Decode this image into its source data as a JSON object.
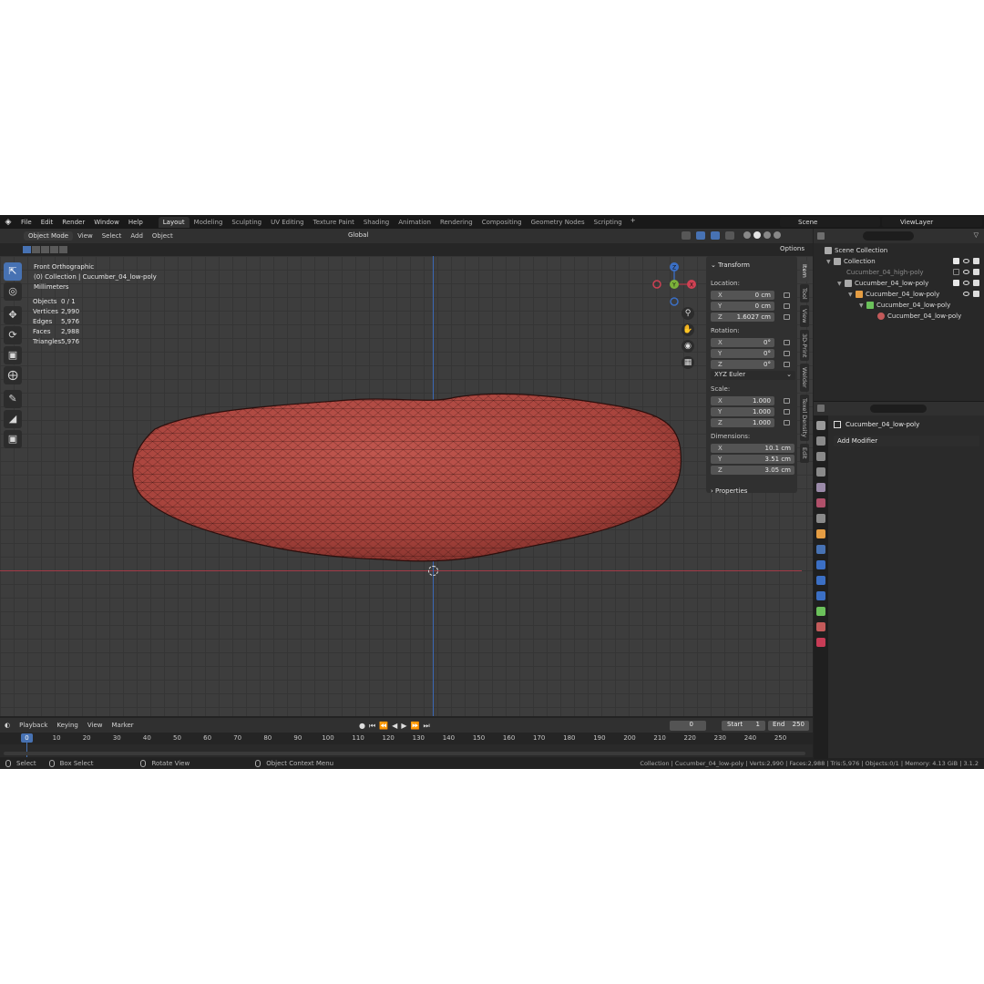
{
  "topbar": {
    "menus": [
      "File",
      "Edit",
      "Render",
      "Window",
      "Help"
    ],
    "workspaces": [
      "Layout",
      "Modeling",
      "Sculpting",
      "UV Editing",
      "Texture Paint",
      "Shading",
      "Animation",
      "Rendering",
      "Compositing",
      "Geometry Nodes",
      "Scripting"
    ],
    "active_workspace": "Layout",
    "add_workspace": "+",
    "scene": "Scene",
    "view_layer": "ViewLayer"
  },
  "viewport_header": {
    "mode": "Object Mode",
    "menus": [
      "View",
      "Select",
      "Add",
      "Object"
    ],
    "orientation": "Global",
    "options": "Options"
  },
  "viewport": {
    "view_name": "Front Orthographic",
    "collection_line": "(0) Collection | Cucumber_04_low-poly",
    "units": "Millimeters",
    "stats": [
      {
        "label": "Objects",
        "value": "0 / 1"
      },
      {
        "label": "Vertices",
        "value": "2,990"
      },
      {
        "label": "Edges",
        "value": "5,976"
      },
      {
        "label": "Faces",
        "value": "2,988"
      },
      {
        "label": "Triangles",
        "value": "5,976"
      }
    ],
    "gizmo": {
      "x": "X",
      "y": "Y",
      "z": "Z"
    },
    "colors": {
      "axis_x": "#a23a47",
      "axis_z": "#3b68b5",
      "mesh": "#b54a44",
      "accent": "#4772b3"
    }
  },
  "npanel": {
    "transform_title": "Transform",
    "location_label": "Location:",
    "location": [
      {
        "axis": "X",
        "value": "0 cm"
      },
      {
        "axis": "Y",
        "value": "0 cm"
      },
      {
        "axis": "Z",
        "value": "1.6027 cm"
      }
    ],
    "rotation_label": "Rotation:",
    "rotation": [
      {
        "axis": "X",
        "value": "0°"
      },
      {
        "axis": "Y",
        "value": "0°"
      },
      {
        "axis": "Z",
        "value": "0°"
      }
    ],
    "rotation_mode": "XYZ Euler",
    "scale_label": "Scale:",
    "scale": [
      {
        "axis": "X",
        "value": "1.000"
      },
      {
        "axis": "Y",
        "value": "1.000"
      },
      {
        "axis": "Z",
        "value": "1.000"
      }
    ],
    "dimensions_label": "Dimensions:",
    "dimensions": [
      {
        "axis": "X",
        "value": "10.1 cm"
      },
      {
        "axis": "Y",
        "value": "3.51 cm"
      },
      {
        "axis": "Z",
        "value": "3.05 cm"
      }
    ],
    "properties": "Properties",
    "tabs": [
      "Item",
      "Tool",
      "View",
      "3D-Print",
      "Welder",
      "Texel Density",
      "Edit"
    ]
  },
  "timeline": {
    "menus": [
      "Playback",
      "Keying",
      "View",
      "Marker"
    ],
    "current_frame": "0",
    "start_label": "Start",
    "start": "1",
    "end_label": "End",
    "end": "250",
    "ruler": [
      "0",
      "10",
      "20",
      "30",
      "40",
      "50",
      "60",
      "70",
      "80",
      "90",
      "100",
      "110",
      "120",
      "130",
      "140",
      "150",
      "160",
      "170",
      "180",
      "190",
      "200",
      "210",
      "220",
      "230",
      "240",
      "250"
    ]
  },
  "statusbar": {
    "select": "Select",
    "box_select": "Box Select",
    "rotate_view": "Rotate View",
    "context_menu": "Object Context Menu",
    "info": "Collection | Cucumber_04_low-poly | Verts:2,990 | Faces:2,988 | Tris:5,976 | Objects:0/1 | Memory: 4.13 GiB | 3.1.2"
  },
  "outliner": {
    "rows": [
      {
        "label": "Scene Collection"
      },
      {
        "label": "Collection"
      },
      {
        "label": "Cucumber_04_high-poly"
      },
      {
        "label": "Cucumber_04_low-poly"
      },
      {
        "label": "Cucumber_04_low-poly"
      },
      {
        "label": "Cucumber_04_low-poly"
      },
      {
        "label": "Cucumber_04_low-poly"
      }
    ]
  },
  "properties": {
    "object_name": "Cucumber_04_low-poly",
    "add_modifier": "Add Modifier"
  }
}
